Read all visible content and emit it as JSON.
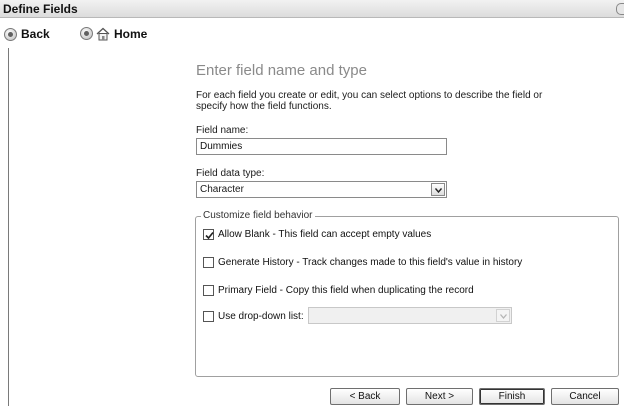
{
  "window": {
    "title": "Define Fields"
  },
  "toolbar": {
    "back_label": "Back",
    "home_label": "Home"
  },
  "page": {
    "heading": "Enter field name and type",
    "description": "For each field you create or edit, you can select options to describe the field or specify how the field functions."
  },
  "field_name": {
    "label": "Field name:",
    "value": "Dummies"
  },
  "field_type": {
    "label": "Field data type:",
    "selected": "Character"
  },
  "behavior": {
    "legend": "Customize field behavior",
    "allow_blank": {
      "label": "Allow Blank - This field can accept empty values",
      "checked": true
    },
    "generate_history": {
      "label": "Generate History - Track changes made to this field's value in history",
      "checked": false
    },
    "primary_field": {
      "label": "Primary Field - Copy this field when duplicating the record",
      "checked": false
    },
    "dropdown": {
      "label": "Use drop-down list:",
      "checked": false,
      "selected": ""
    }
  },
  "buttons": {
    "back": "< Back",
    "next": "Next >",
    "finish": "Finish",
    "cancel": "Cancel"
  }
}
